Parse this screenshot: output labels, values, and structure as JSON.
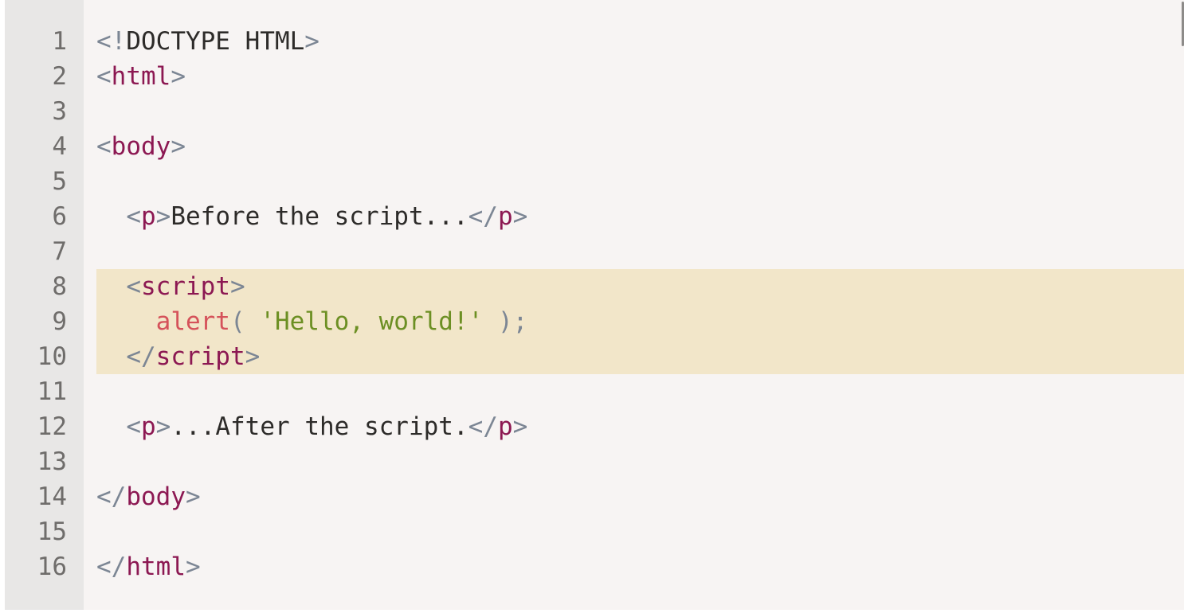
{
  "editor": {
    "lines": [
      {
        "num": "1",
        "segments": [
          [
            "punc",
            "<!"
          ],
          [
            "text",
            "DOCTYPE HTML"
          ],
          [
            "punc",
            ">"
          ]
        ]
      },
      {
        "num": "2",
        "segments": [
          [
            "punc",
            "<"
          ],
          [
            "tag",
            "html"
          ],
          [
            "punc",
            ">"
          ]
        ]
      },
      {
        "num": "3",
        "segments": []
      },
      {
        "num": "4",
        "segments": [
          [
            "punc",
            "<"
          ],
          [
            "tag",
            "body"
          ],
          [
            "punc",
            ">"
          ]
        ]
      },
      {
        "num": "5",
        "segments": []
      },
      {
        "num": "6",
        "segments": [
          [
            "text",
            "  "
          ],
          [
            "punc",
            "<"
          ],
          [
            "tag",
            "p"
          ],
          [
            "punc",
            ">"
          ],
          [
            "text",
            "Before the script..."
          ],
          [
            "punc",
            "</"
          ],
          [
            "tag",
            "p"
          ],
          [
            "punc",
            ">"
          ]
        ]
      },
      {
        "num": "7",
        "segments": []
      },
      {
        "num": "8",
        "highlight": true,
        "segments": [
          [
            "text",
            "  "
          ],
          [
            "punc",
            "<"
          ],
          [
            "tag",
            "script"
          ],
          [
            "punc",
            ">"
          ]
        ]
      },
      {
        "num": "9",
        "highlight": true,
        "segments": [
          [
            "text",
            "    "
          ],
          [
            "fn",
            "alert"
          ],
          [
            "punc",
            "( "
          ],
          [
            "str",
            "'Hello, world!'"
          ],
          [
            "punc",
            " );"
          ]
        ]
      },
      {
        "num": "10",
        "highlight": true,
        "segments": [
          [
            "text",
            "  "
          ],
          [
            "punc",
            "</"
          ],
          [
            "tag",
            "script"
          ],
          [
            "punc",
            ">"
          ]
        ]
      },
      {
        "num": "11",
        "segments": []
      },
      {
        "num": "12",
        "segments": [
          [
            "text",
            "  "
          ],
          [
            "punc",
            "<"
          ],
          [
            "tag",
            "p"
          ],
          [
            "punc",
            ">"
          ],
          [
            "text",
            "...After the script."
          ],
          [
            "punc",
            "</"
          ],
          [
            "tag",
            "p"
          ],
          [
            "punc",
            ">"
          ]
        ]
      },
      {
        "num": "13",
        "segments": []
      },
      {
        "num": "14",
        "segments": [
          [
            "punc",
            "</"
          ],
          [
            "tag",
            "body"
          ],
          [
            "punc",
            ">"
          ]
        ]
      },
      {
        "num": "15",
        "segments": []
      },
      {
        "num": "16",
        "segments": [
          [
            "punc",
            "</"
          ],
          [
            "tag",
            "html"
          ],
          [
            "punc",
            ">"
          ]
        ]
      }
    ]
  },
  "colors": {
    "background": "#f7f4f3",
    "gutter": "#e8e7e6",
    "highlight": "#f2e6c9",
    "punctuation": "#7c8694",
    "tag": "#8c1852",
    "text": "#2d2b29",
    "function": "#d5525a",
    "string": "#6c8f23",
    "line_number": "#6f6d6b"
  }
}
